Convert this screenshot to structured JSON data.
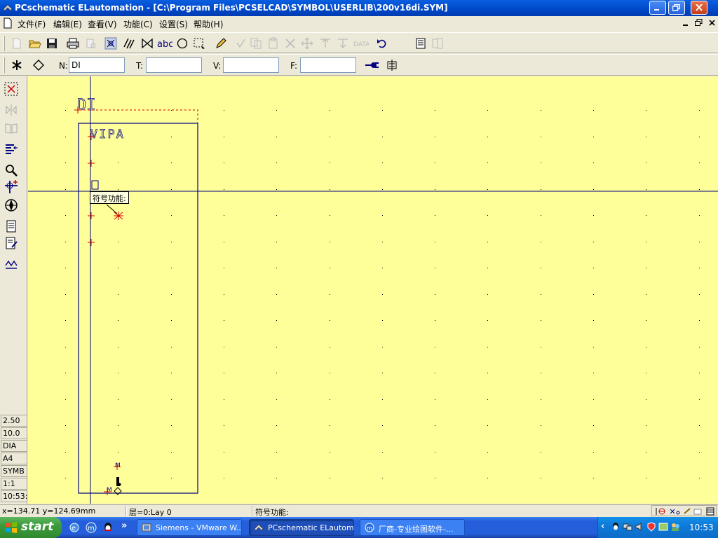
{
  "window": {
    "title": "PCschematic ELautomation - [C:\\Program Files\\PCSELCAD\\SYMBOL\\USERLIB\\200v16di.SYM]"
  },
  "menu": {
    "items": [
      "文件(F)",
      "编辑(E)",
      "查看(V)",
      "功能(C)",
      "设置(S)",
      "帮助(H)"
    ]
  },
  "toolbar2": {
    "n_label": "N:",
    "n_value": "DI",
    "t_label": "T:",
    "t_value": "",
    "v_label": "V:",
    "v_value": "",
    "f_label": "F:",
    "f_value": ""
  },
  "info_panel": [
    "2.50",
    "10.0",
    "DIA",
    "A4",
    "SYMB",
    "1:1",
    "10:53:"
  ],
  "canvas": {
    "symbol_name": "DI",
    "symbol_type": "VIPA",
    "tooltip": "符号功能:",
    "marker_label": "M"
  },
  "status": {
    "coords": "x=134.71 y=124.69mm",
    "layer": "层=0:Lay 0",
    "function": "符号功能:"
  },
  "taskbar": {
    "start_label": "start",
    "tasks": [
      "Siemens - VMware W...",
      "PCschematic ELautom...",
      "厂商-专业绘图软件-..."
    ],
    "clock": "10:53"
  },
  "colors": {
    "canvas_bg": "#ffff99",
    "symbol_blue": "#000080",
    "pin_red": "#d00000",
    "titlebar_blue": "#0047c8",
    "taskbar_blue": "#245edb"
  }
}
